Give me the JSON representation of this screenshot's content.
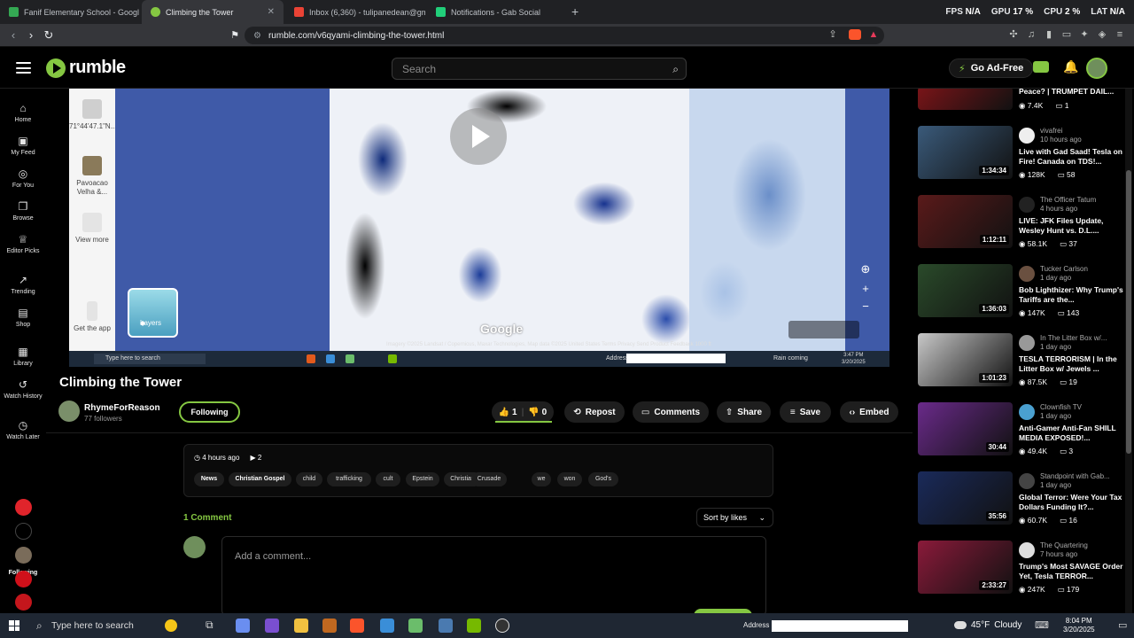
{
  "browser": {
    "tabs": [
      {
        "title": "Fanif Elementary School - Google M",
        "favicon_color": "#34a853"
      },
      {
        "title": "Climbing the Tower",
        "favicon_color": "#85c742",
        "active": true
      },
      {
        "title": "Inbox (6,360) - tulipanedean@gma",
        "favicon_color": "#ea4335"
      },
      {
        "title": "Notifications - Gab Social",
        "favicon_color": "#21cf7a"
      }
    ],
    "new_tab_label": "+",
    "url": "rumble.com/v6qyami-climbing-the-tower.html",
    "hud": {
      "fps_label": "FPS",
      "fps_value": "N/A",
      "gpu_label": "GPU",
      "gpu_value": "17 %",
      "cpu_label": "CPU",
      "cpu_value": "2 %",
      "lat_label": "LAT",
      "lat_value": "N/A"
    }
  },
  "header": {
    "logo_text": "rumble",
    "search_placeholder": "Search",
    "ad_free_label": "Go Ad-Free"
  },
  "leftnav": {
    "items": [
      {
        "label": "Home",
        "icon": "home-icon",
        "glyph": "⌂"
      },
      {
        "label": "My Feed",
        "icon": "feed-icon",
        "glyph": "▣"
      },
      {
        "label": "For You",
        "icon": "for-you-icon",
        "glyph": "◎"
      },
      {
        "label": "Browse",
        "icon": "browse-icon",
        "glyph": "❐"
      },
      {
        "label": "Editor Picks",
        "icon": "editor-picks-icon",
        "glyph": "♕"
      },
      {
        "label": "Trending",
        "icon": "trending-icon",
        "glyph": "↗"
      },
      {
        "label": "Shop",
        "icon": "shop-icon",
        "glyph": "▤"
      },
      {
        "label": "Library",
        "icon": "library-icon",
        "glyph": "▦"
      },
      {
        "label": "Watch History",
        "icon": "history-icon",
        "glyph": "↺"
      },
      {
        "label": "Watch Later",
        "icon": "watch-later-icon",
        "glyph": "◷"
      }
    ],
    "following_label": "Following",
    "following_colors": [
      "#e0242b",
      "#000000",
      "#7a6c5a",
      "#d0101a",
      "#c4161c"
    ]
  },
  "player": {
    "sidebar_items": [
      {
        "label": "71°44'47.1\"N..."
      },
      {
        "label": "Pavoacao Velha &..."
      },
      {
        "label": "View more"
      },
      {
        "label": "Get the app"
      }
    ],
    "layers_label": "Layers",
    "google_watermark": "Google",
    "attribution": "Imagery ©2025 Landsat / Copernicus, Maxar Technologies, Map data ©2025   United States   Terms   Privacy   Send Product Feedback   1000 ft",
    "taskbar_search": "Type here to search",
    "taskbar_address": "Address",
    "taskbar_weather": "Rain coming",
    "taskbar_time": "3:47 PM",
    "taskbar_date": "3/20/2025"
  },
  "video": {
    "title": "Climbing the Tower",
    "channel_name": "RhymeForReason",
    "followers": "77 followers",
    "following_label": "Following",
    "likes": "1",
    "dislikes": "0",
    "like_ratio": 1.0,
    "actions": {
      "repost": "Repost",
      "comments": "Comments",
      "share": "Share",
      "save": "Save",
      "embed": "Embed"
    },
    "posted": "4 hours ago",
    "views": "2",
    "tags": [
      "News",
      "Christian Gospel",
      "child",
      "trafficking",
      "cult",
      "Epstein",
      "Christian",
      "Crusade",
      "we",
      "won",
      "God's"
    ],
    "tags_bold": [
      "News",
      "Christian Gospel"
    ]
  },
  "comments": {
    "count_label": "1 Comment",
    "sort_label": "Sort by likes",
    "placeholder": "Add a comment..."
  },
  "rail": [
    {
      "channel": "",
      "ago": "",
      "title": "Peace? | TRUMPET DAIL...",
      "views": "7.4K",
      "comments": "1",
      "duration": "",
      "thumb_color": "#7a1418",
      "avatar_color": "#333333"
    },
    {
      "channel": "vivafrei",
      "ago": "10 hours ago",
      "title": "Live with Gad Saad! Tesla on Fire! Canada on TDS!...",
      "views": "128K",
      "comments": "58",
      "duration": "1:34:34",
      "thumb_color": "#3a5a7a",
      "avatar_color": "#eeeeee"
    },
    {
      "channel": "The Officer Tatum",
      "ago": "4 hours ago",
      "title": "LIVE: JFK Files Update, Wesley Hunt vs. D.L....",
      "views": "58.1K",
      "comments": "37",
      "duration": "1:12:11",
      "thumb_color": "#5a1a1a",
      "avatar_color": "#222222"
    },
    {
      "channel": "Tucker Carlson",
      "ago": "1 day ago",
      "title": "Bob Lighthizer: Why Trump's Tariffs are the...",
      "views": "147K",
      "comments": "143",
      "duration": "1:36:03",
      "thumb_color": "#2a4a2a",
      "avatar_color": "#6a5040"
    },
    {
      "channel": "In The Litter Box w/...",
      "ago": "1 day ago",
      "title": "TESLA TERRORISM | In the Litter Box w/ Jewels ...",
      "views": "87.5K",
      "comments": "19",
      "duration": "1:01:23",
      "thumb_color": "#c8c8c8",
      "avatar_color": "#999999"
    },
    {
      "channel": "Clownfish TV",
      "ago": "1 day ago",
      "title": "Anti-Gamer Anti-Fan SHILL MEDIA EXPOSED!...",
      "views": "49.4K",
      "comments": "3",
      "duration": "30:44",
      "thumb_color": "#6a2a8a",
      "avatar_color": "#4aa0d0"
    },
    {
      "channel": "Standpoint with Gab...",
      "ago": "1 day ago",
      "title": "Global Terror: Were Your Tax Dollars Funding It?...",
      "views": "60.7K",
      "comments": "16",
      "duration": "35:56",
      "thumb_color": "#1a2a5a",
      "avatar_color": "#444444"
    },
    {
      "channel": "The Quartering",
      "ago": "7 hours ago",
      "title": "Trump's Most SAVAGE Order Yet, Tesla TERROR...",
      "views": "247K",
      "comments": "179",
      "duration": "2:33:27",
      "thumb_color": "#8a1a3a",
      "avatar_color": "#dddddd"
    }
  ],
  "taskbar": {
    "search_placeholder": "Type here to search",
    "address_label": "Address",
    "temperature": "45°F",
    "condition": "Cloudy",
    "time": "8:04 PM",
    "date": "3/20/2025"
  },
  "colors": {
    "accent": "#85c742",
    "background": "#000000"
  }
}
